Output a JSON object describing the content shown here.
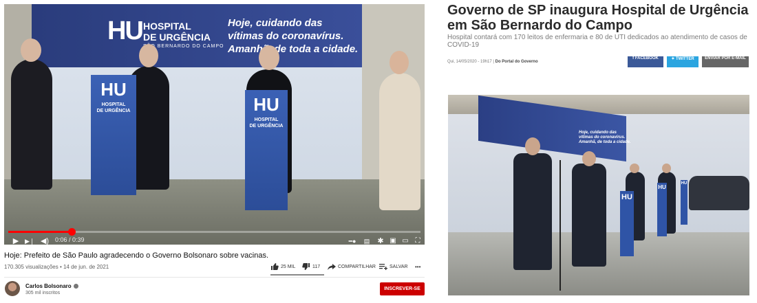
{
  "video": {
    "banner_brand": "HU",
    "banner_name_1": "HOSPITAL",
    "banner_name_2": "DE URGÊNCIA",
    "banner_place": "SÃO BERNARDO DO CAMPO",
    "banner_slogan_1": "Hoje, cuidando das",
    "banner_slogan_2": "vítimas do coronavírus.",
    "banner_slogan_3": "Amanhã, de toda a cidade.",
    "podium_label_1": "HOSPITAL",
    "podium_label_2": "DE URGÊNCIA",
    "time_display": "0:06 / 0:39",
    "progress_fraction": 0.154,
    "title": "Hoje: Prefeito de São Paulo agradecendo o Governo Bolsonaro sobre vacinas.",
    "meta": "170.305 visualizações • 14 de jun. de 2021",
    "likes": "25 MIL",
    "dislikes": "117",
    "share_label": "COMPARTILHAR",
    "save_label": "SALVAR",
    "more_label": "•••",
    "channel_name": "Carlos Bolsonaro",
    "channel_subs": "305 mil inscritos",
    "subscribe_label": "INSCREVER-SE",
    "accent_color": "#cc0000"
  },
  "article": {
    "title": "Governo de SP inaugura Hospital de Urgência em São Bernardo do Campo",
    "subtitle": "Hospital contará com 170 leitos de enfermaria e 80 de UTI dedicados ao atendimento de casos de COVID-19",
    "date": "Qui, 14/05/2020 - 19h17 |",
    "source": "Do Portal do Governo",
    "facebook_label": "f FACEBOOK",
    "twitter_label": "TWITTER",
    "email_label": "ENVIAR POR E-MAIL",
    "facebook_color": "#3b5998",
    "twitter_color": "#2ba5e0",
    "email_color": "#666666",
    "photo_brand": "HU",
    "photo_slogan_1": "Hoje, cuidando das",
    "photo_slogan_2": "vítimas do coronavírus.",
    "photo_slogan_3": "Amanhã, de toda a cidade."
  }
}
